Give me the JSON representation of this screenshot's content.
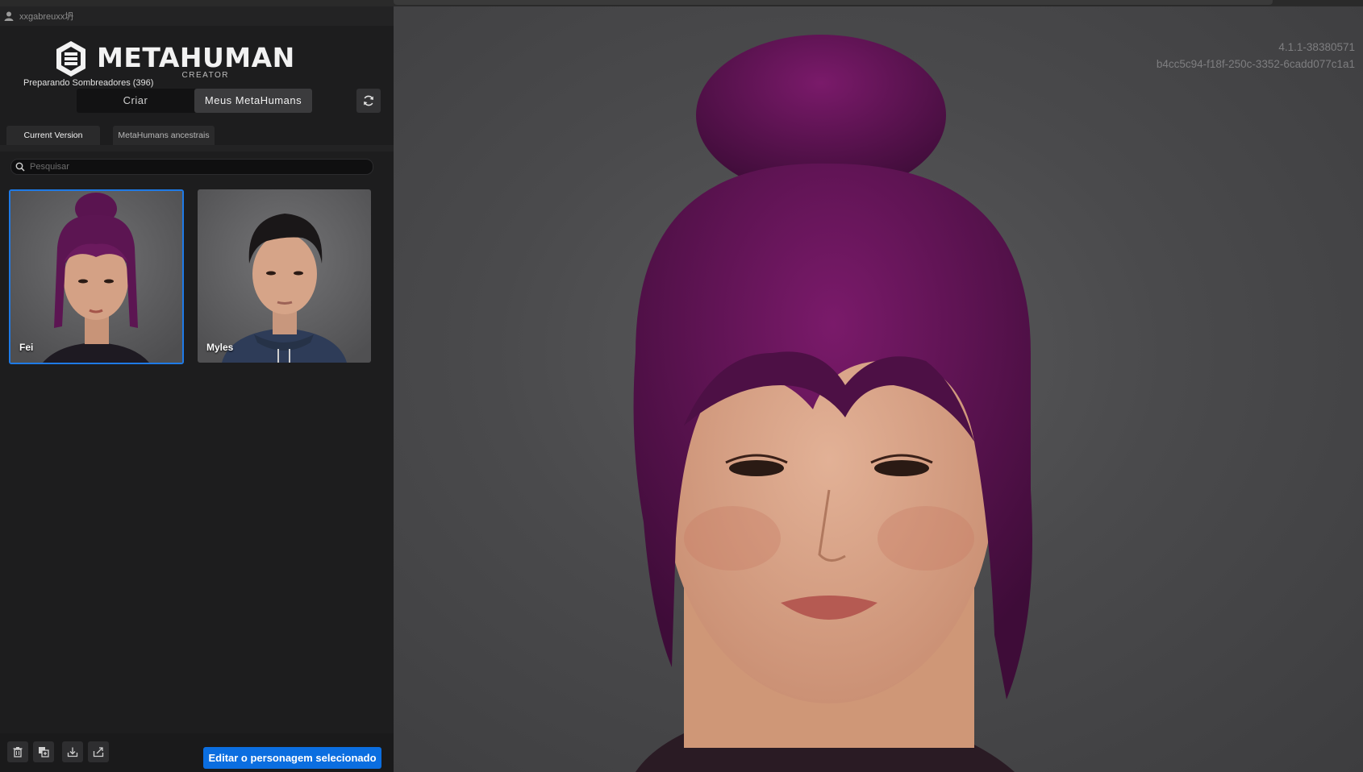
{
  "user": {
    "name": "xxgabreuxx坍"
  },
  "logo": {
    "word": "METAHUMAN",
    "sub": "CREATOR"
  },
  "status": "Preparando Sombreadores (396)",
  "modes": {
    "criar": "Criar",
    "meus": "Meus MetaHumans"
  },
  "icons": {
    "user": "user-icon",
    "refresh": "refresh-icon",
    "search": "search-icon",
    "delete": "trash-icon",
    "duplicate": "duplicate-icon",
    "download": "download-icon",
    "export": "export-icon"
  },
  "version_tabs": {
    "current": "Current Version",
    "ancestral": "MetaHumans ancestrais"
  },
  "search": {
    "placeholder": "Pesquisar"
  },
  "characters": [
    {
      "name": "Fei",
      "selected": true
    },
    {
      "name": "Myles",
      "selected": false
    }
  ],
  "footer": {
    "edit_label": "Editar o personagem selecionado"
  },
  "viewport": {
    "build": "4.1.1-38380571",
    "id": "b4cc5c94-f18f-250c-3352-6cadd077c1a1"
  },
  "colors": {
    "accent": "#0b6ee0",
    "selected_border": "#1f7ae6",
    "hair": "#5a1450"
  }
}
